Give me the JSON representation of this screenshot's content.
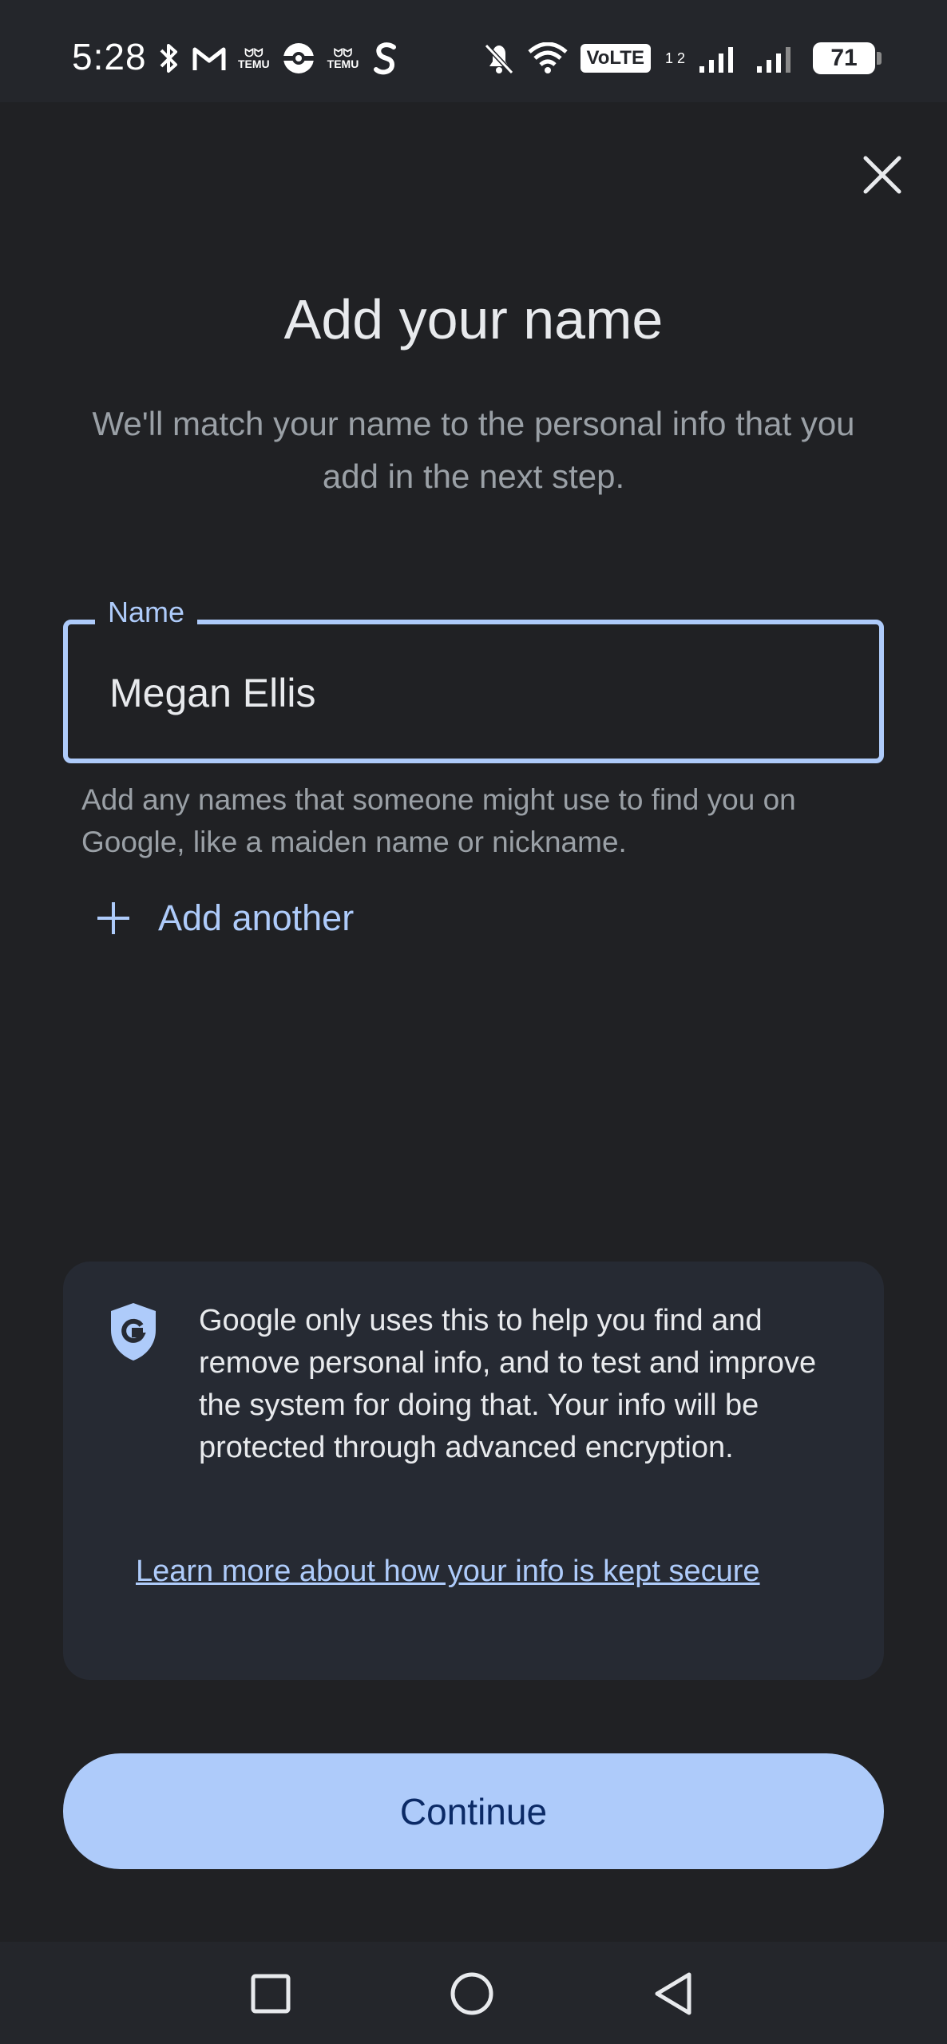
{
  "status_bar": {
    "time": "5:28",
    "temu_label": "TEMU",
    "volte_label": "VoLTE",
    "volte_sub": "1 2",
    "battery_level": "71",
    "left_icons": [
      "bluetooth-icon",
      "gmail-icon",
      "temu-icon",
      "pokeball-icon",
      "temu-icon",
      "shazam-icon"
    ],
    "right_icons": [
      "mute-icon",
      "wifi-icon",
      "volte-icon",
      "signal-icon",
      "signal-icon",
      "battery-icon"
    ]
  },
  "header": {
    "close_icon": "close-icon"
  },
  "main": {
    "title": "Add your name",
    "subtitle": "We'll match your name to the personal info that you add in the next step.",
    "name_field": {
      "label": "Name",
      "value": "Megan Ellis"
    },
    "helper_text": "Add any names that someone might use to find you on Google, like a maiden name or nickname.",
    "add_another_label": "Add another",
    "accent_color": "#aecbfa"
  },
  "info_card": {
    "icon": "google-shield-icon",
    "text": "Google only uses this to help you find and remove personal info, and to test and improve the system for doing that. Your info will be protected through advanced encryption.",
    "link_label": "Learn more about how your info is kept secure"
  },
  "footer": {
    "continue_label": "Continue"
  },
  "nav_bar": {
    "items": [
      "recents-icon",
      "home-icon",
      "back-icon"
    ]
  }
}
